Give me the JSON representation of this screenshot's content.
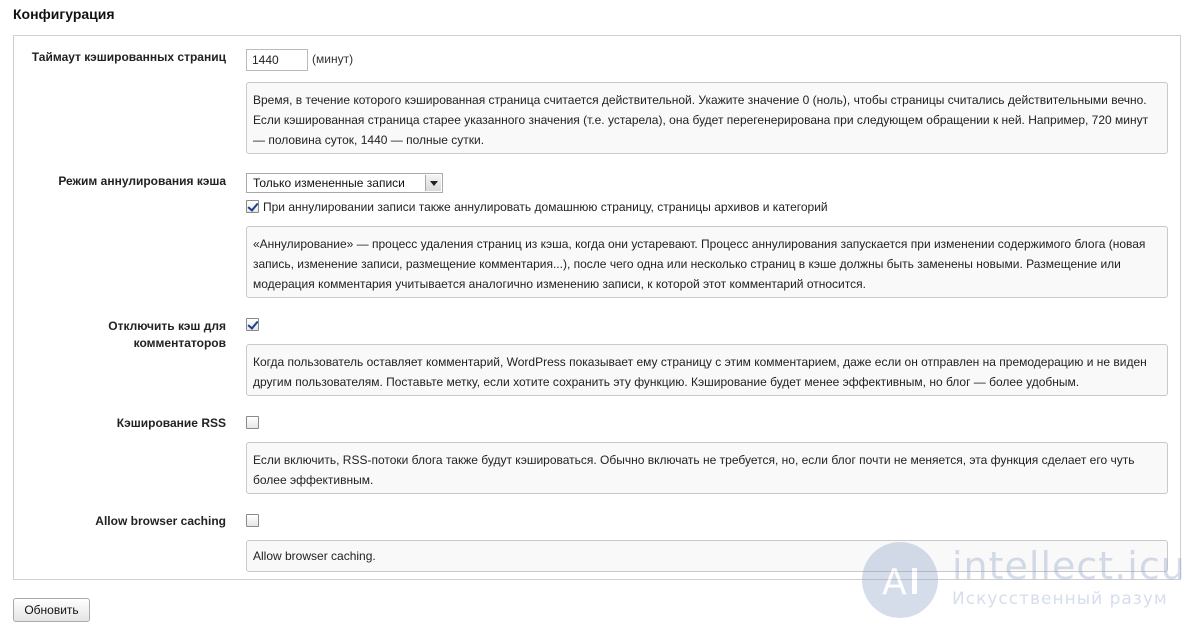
{
  "section": {
    "title": "Конфигурация"
  },
  "timeout": {
    "label": "Таймаут кэшированных страниц",
    "value": "1440",
    "unit": "(минут)",
    "description": "Время, в течение которого кэшированная страница считается действительной. Укажите значение 0 (ноль), чтобы страницы считались действительными вечно. Если кэшированная страница старее указанного значения (т.е. устарела), она будет перегенерирована при следующем обращении к ней. Например, 720 минут — половина суток, 1440 — полные сутки."
  },
  "invalidation": {
    "label": "Режим аннулирования кэша",
    "selected": "Только измененные записи",
    "home_checkbox_label": "При аннулировании записи также аннулировать домашнюю страницу, страницы архивов и категорий",
    "home_checked": true,
    "description": "«Аннулирование» — процесс удаления страниц из кэша, когда они устаревают. Процесс аннулирования запускается при изменении содержимого блога (новая запись, изменение записи, размещение комментария...), после чего одна или несколько страниц в кэше должны быть заменены новыми. Размещение или модерация комментария учитывается аналогично изменению записи, к которой этот комментарий относится."
  },
  "commenters": {
    "label_line1": "Отключить кэш для",
    "label_line2": "комментаторов",
    "checked": true,
    "description": "Когда пользователь оставляет комментарий, WordPress показывает ему страницу с этим комментарием, даже если он отправлен на премодерацию и не виден другим пользователям. Поставьте метку, если хотите сохранить эту функцию. Кэширование будет менее эффективным, но блог — более удобным."
  },
  "rss": {
    "label": "Кэширование RSS",
    "checked": false,
    "description": "Если включить, RSS-потоки блога также будут кэшироваться. Обычно включать не требуется, но, если блог почти не меняется, эта функция сделает его чуть более эффективным."
  },
  "browser": {
    "label": "Allow browser caching",
    "checked": false,
    "description": "Allow browser caching."
  },
  "actions": {
    "update_label": "Обновить"
  },
  "watermark": {
    "text": "intellect.icu",
    "subtitle": "Искусственный разум"
  }
}
